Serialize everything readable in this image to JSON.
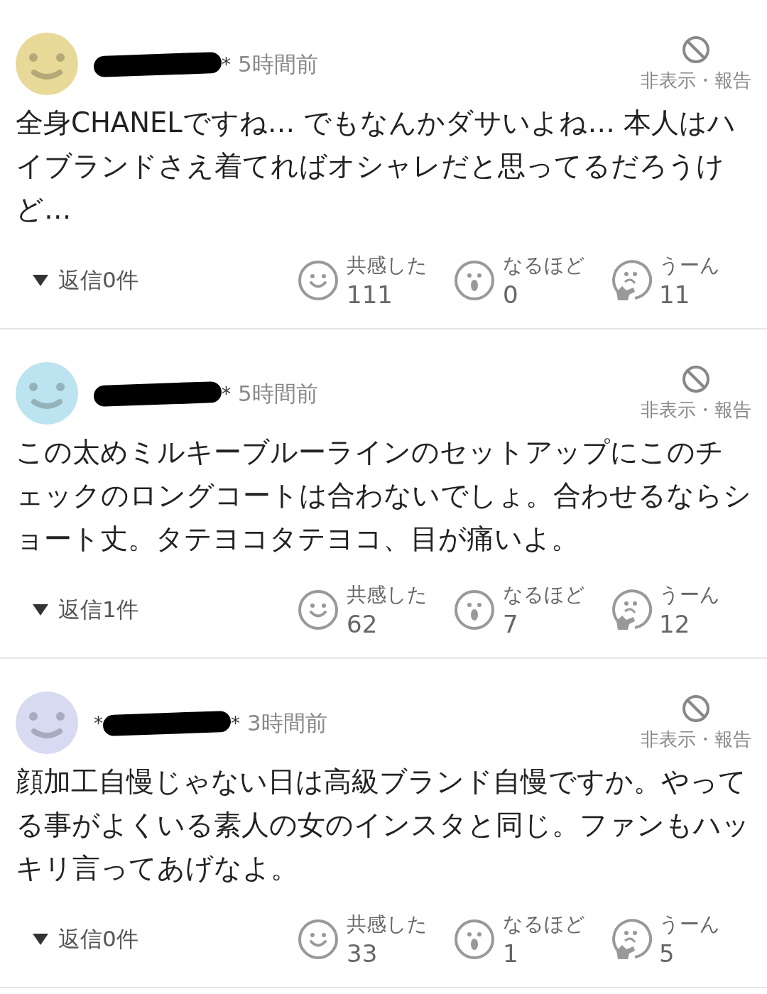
{
  "comments": [
    {
      "color": "#e8d998",
      "name_suffix": "*",
      "time": "5時間前",
      "hide_label": "非表示・報告",
      "body": "全身CHANELですね… でもなんかダサいよね… 本人はハイブランドさえ着てればオシャレだと思ってるだろうけど…",
      "replies": "返信0件",
      "reactions": [
        {
          "kind": "agree",
          "label": "共感した",
          "count": "111"
        },
        {
          "kind": "insight",
          "label": "なるほど",
          "count": "0"
        },
        {
          "kind": "doubt",
          "label": "うーん",
          "count": "11"
        }
      ]
    },
    {
      "color": "#bce4f0",
      "name_suffix": "*",
      "time": "5時間前",
      "hide_label": "非表示・報告",
      "body": "この太めミルキーブルーラインのセットアップにこのチェックのロングコートは合わないでしょ。合わせるならショート丈。タテヨコタテヨコ、目が痛いよ。",
      "replies": "返信1件",
      "reactions": [
        {
          "kind": "agree",
          "label": "共感した",
          "count": "62"
        },
        {
          "kind": "insight",
          "label": "なるほど",
          "count": "7"
        },
        {
          "kind": "doubt",
          "label": "うーん",
          "count": "12"
        }
      ]
    },
    {
      "color": "#d8daf2",
      "name_prefix": "*",
      "name_suffix": "*",
      "time": "3時間前",
      "hide_label": "非表示・報告",
      "body": "顔加工自慢じゃない日は高級ブランド自慢ですか。やってる事がよくいる素人の女のインスタと同じ。ファンもハッキリ言ってあげなよ。",
      "replies": "返信0件",
      "reactions": [
        {
          "kind": "agree",
          "label": "共感した",
          "count": "33"
        },
        {
          "kind": "insight",
          "label": "なるほど",
          "count": "1"
        },
        {
          "kind": "doubt",
          "label": "うーん",
          "count": "5"
        }
      ]
    }
  ]
}
